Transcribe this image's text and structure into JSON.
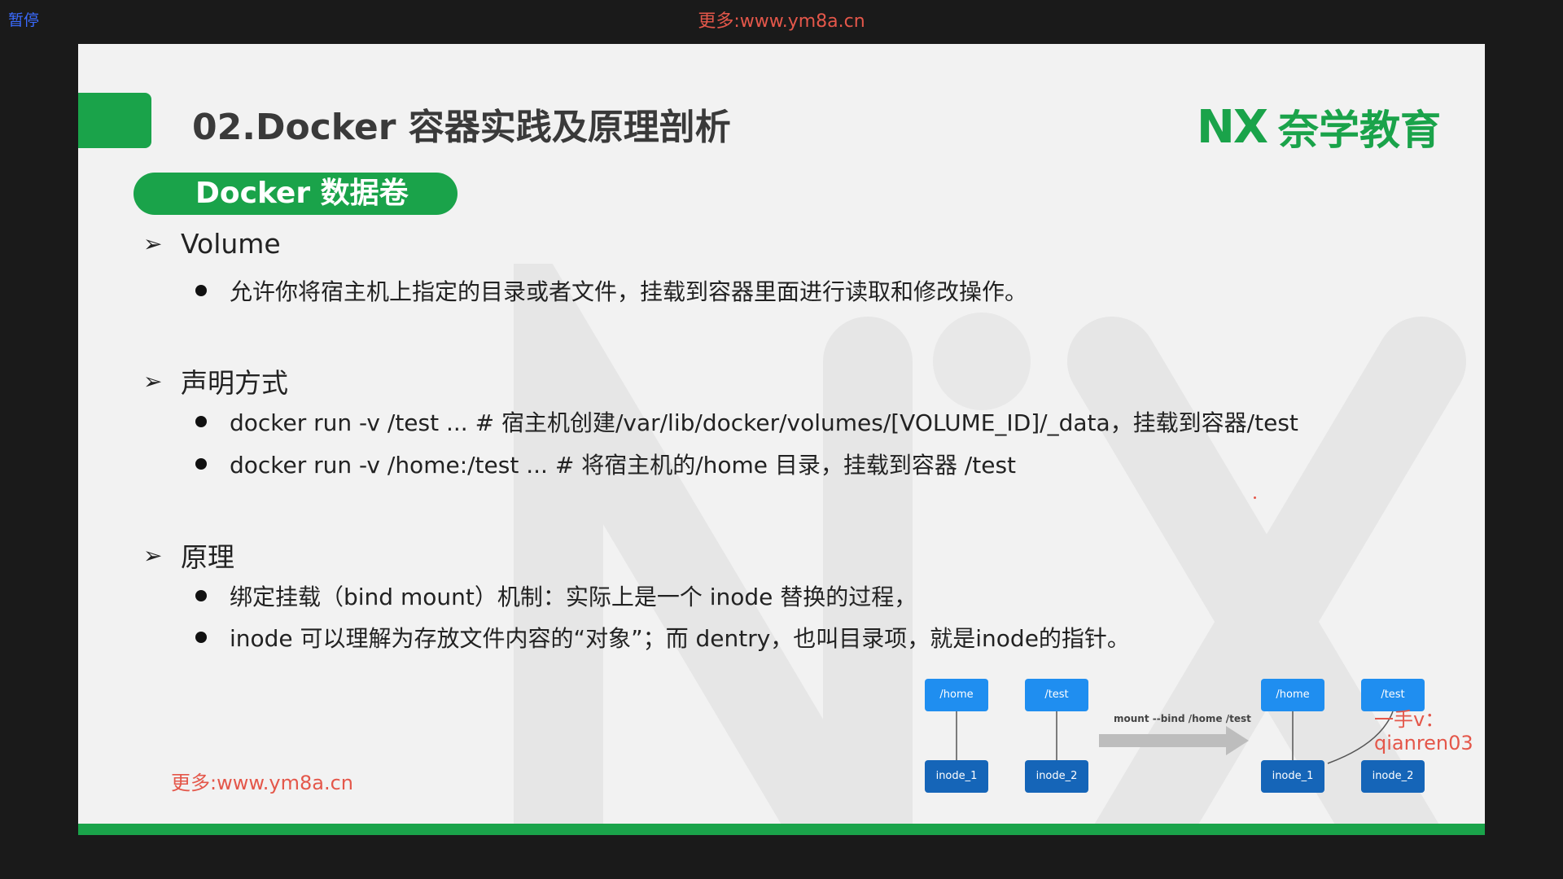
{
  "overlay": {
    "pause_label": "暂停",
    "top_watermark": "更多:www.ym8a.cn",
    "bottom_watermark": "更多:www.ym8a.cn",
    "side_watermark": "一手v：qianren03"
  },
  "slide": {
    "title": "02.Docker 容器实践及原理剖析",
    "brand_mark": "NX",
    "brand_text": "奈学教育",
    "section_pill": "Docker 数据卷",
    "sections": [
      {
        "heading": "Volume",
        "bullets": [
          "允许你将宿主机上指定的目录或者文件，挂载到容器里面进行读取和修改操作。"
        ]
      },
      {
        "heading": "声明方式",
        "bullets": [
          "docker run -v /test ... # 宿主机创建/var/lib/docker/volumes/[VOLUME_ID]/_data，挂载到容器/test",
          "docker run -v /home:/test ... # 将宿主机的/home 目录，挂载到容器 /test"
        ]
      },
      {
        "heading": "原理",
        "bullets": [
          "绑定挂载（bind mount）机制：实际上是一个 inode 替换的过程，",
          "inode 可以理解为存放文件内容的“对象”；而 dentry，也叫目录项，就是inode的指针。"
        ]
      }
    ],
    "diagram": {
      "mount_label": "mount --bind /home /test",
      "before": {
        "dir_a": "/home",
        "dir_b": "/test",
        "inode_a": "inode_1",
        "inode_b": "inode_2"
      },
      "after": {
        "dir_a": "/home",
        "dir_b": "/test",
        "inode_a": "inode_1",
        "inode_b": "inode_2"
      }
    }
  },
  "colors": {
    "accent_green": "#1aa34a",
    "watermark_red": "#e4574a",
    "node_blue": "#1f8ef0",
    "node_dark_blue": "#1565b8"
  }
}
